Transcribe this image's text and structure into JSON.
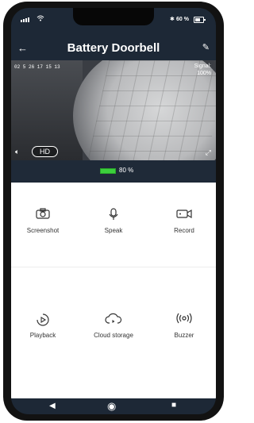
{
  "status": {
    "battery": "60 %"
  },
  "header": {
    "title": "Battery Doorbell"
  },
  "camera": {
    "timestamp": "02 5 26 17 15 13",
    "signal_label": "Signal:",
    "signal_value": "100%",
    "quality": "HD"
  },
  "device": {
    "battery": "80 %",
    "battery_level": 0.8
  },
  "actions": [
    {
      "label": "Screenshot"
    },
    {
      "label": "Speak"
    },
    {
      "label": "Record"
    },
    {
      "label": "Playback"
    },
    {
      "label": "Cloud storage"
    },
    {
      "label": "Buzzer"
    }
  ],
  "colors": {
    "accent": "#3ccf3c",
    "header_bg": "#1d2836"
  }
}
